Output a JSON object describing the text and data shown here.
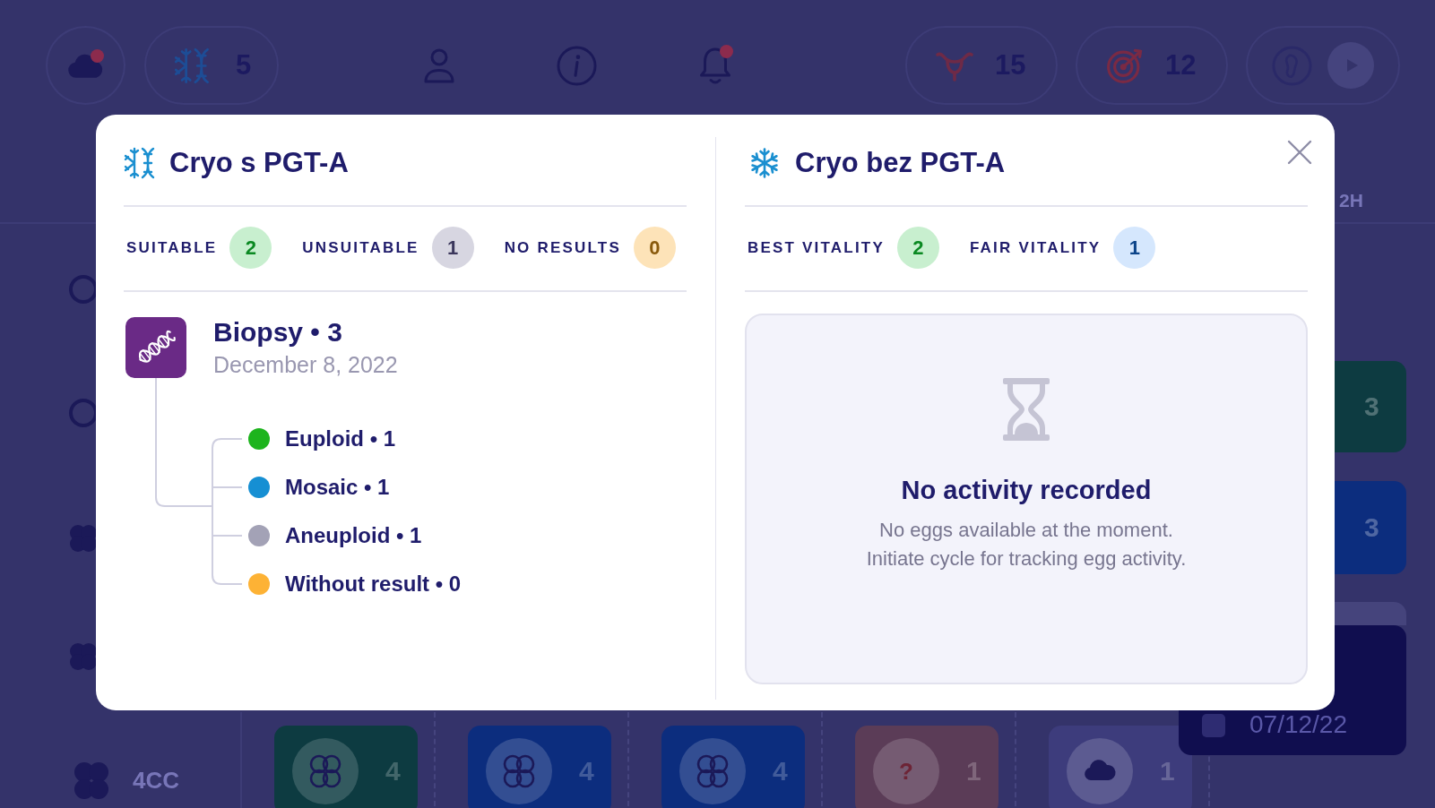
{
  "app": {
    "top_bar": {
      "weather": {
        "notification": true
      },
      "cryo": {
        "count": "5"
      },
      "alerts": {
        "notification": true
      },
      "counters": [
        {
          "kind": "uterus",
          "count": "15"
        },
        {
          "kind": "target",
          "count": "12"
        }
      ]
    },
    "timeline": {
      "time_label": "2H"
    },
    "side_tiles": [
      {
        "count": "3",
        "color": "#0d3b41"
      },
      {
        "count": "3",
        "color": "#0c2d7e"
      }
    ],
    "date_tile": {
      "date": "07/12/22"
    },
    "bottom_row": {
      "label": "4CC",
      "tiles": [
        {
          "kind": "embryo",
          "count": "4",
          "color": "#0d3b41"
        },
        {
          "kind": "embryo",
          "count": "4",
          "color": "#0c2d7e"
        },
        {
          "kind": "embryo",
          "count": "4",
          "color": "#0c2d7e"
        },
        {
          "kind": "unknown",
          "symbol": "?",
          "count": "1",
          "color": "#5b3c57"
        },
        {
          "kind": "cloud",
          "count": "1",
          "color": "#3d3c7c"
        }
      ]
    }
  },
  "modal": {
    "panels": [
      {
        "kind": "pgt",
        "title": "Cryo s PGT-A",
        "stats": [
          {
            "label": "SUITABLE",
            "count": "2",
            "color": "#c8efcf"
          },
          {
            "label": "UNSUITABLE",
            "count": "1",
            "color": "#d7d6e1"
          },
          {
            "label": "NO RESULTS",
            "count": "0",
            "color": "#fde3b8"
          }
        ],
        "biopsy": {
          "title": "Biopsy • 3",
          "date": "December 8, 2022",
          "children": [
            {
              "label": "Euploid • 1",
              "color": "#1db41d"
            },
            {
              "label": "Mosaic • 1",
              "color": "#168fd3"
            },
            {
              "label": "Aneuploid • 1",
              "color": "#a3a2b6"
            },
            {
              "label": "Without result • 0",
              "color": "#fdb235"
            }
          ]
        }
      },
      {
        "kind": "no-pgt",
        "title": "Cryo bez PGT-A",
        "stats": [
          {
            "label": "BEST VITALITY",
            "count": "2",
            "color": "#c8efcf"
          },
          {
            "label": "FAIR VITALITY",
            "count": "1",
            "color": "#d5e7fd"
          }
        ],
        "empty_state": {
          "title": "No activity recorded",
          "lines": [
            "No eggs available at the moment.",
            "Initiate cycle for tracking egg activity."
          ]
        }
      }
    ]
  }
}
